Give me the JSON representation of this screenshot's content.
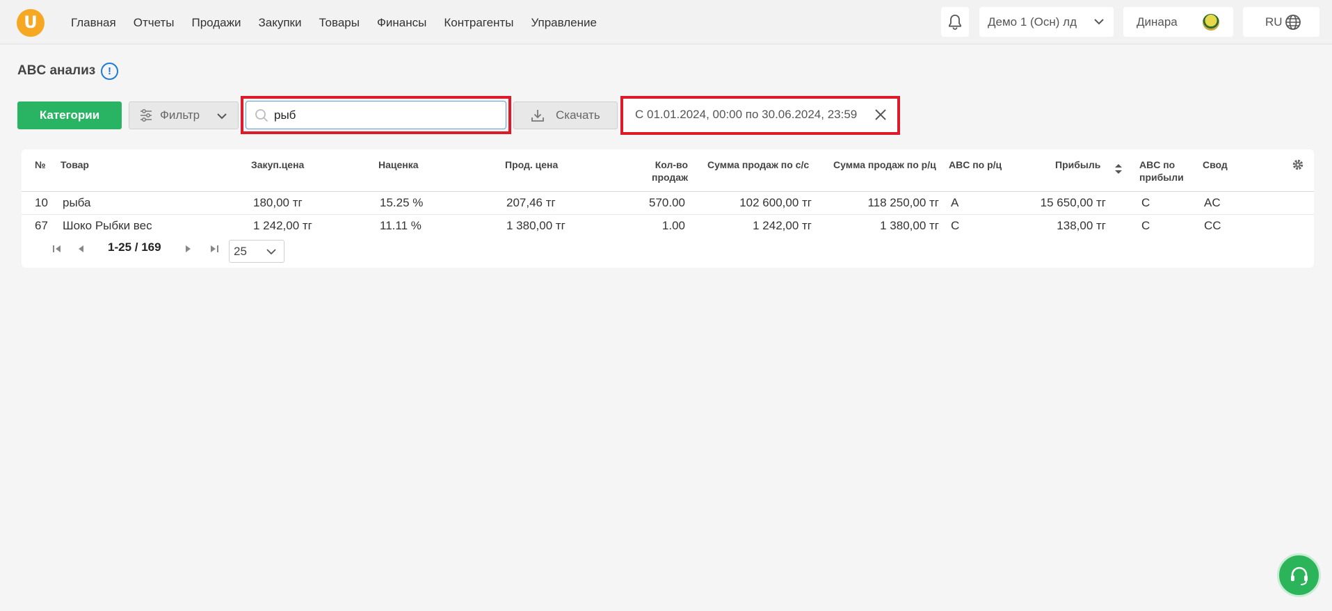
{
  "header": {
    "logo_letter": "U",
    "nav": [
      "Главная",
      "Отчеты",
      "Продажи",
      "Закупки",
      "Товары",
      "Финансы",
      "Контрагенты",
      "Управление"
    ],
    "company": "Демо 1 (Осн) лд",
    "user": "Динара",
    "language": "RU"
  },
  "page": {
    "title": "ABC анализ",
    "info_symbol": "!"
  },
  "toolbar": {
    "categories_label": "Категории",
    "filter_label": "Фильтр",
    "search_value": "рыб",
    "download_label": "Скачать",
    "date_range": "С 01.01.2024, 00:00 по 30.06.2024, 23:59"
  },
  "table": {
    "headers": {
      "num": "№",
      "product": "Товар",
      "purchase_price": "Закуп.цена",
      "markup": "Наценка",
      "sale_price": "Прод. цена",
      "qty_line1": "Кол-во",
      "qty_line2": "продаж",
      "sum_cost": "Сумма продаж по с/с",
      "sum_retail": "Сумма продаж по р/ц",
      "abc_retail": "ABC по р/ц",
      "profit": "Прибыль",
      "abc_profit_line1": "ABC по",
      "abc_profit_line2": "прибыли",
      "summary": "Свод"
    },
    "rows": [
      {
        "num": "10",
        "product": "рыба",
        "purchase_price": "180,00 тг",
        "markup": "15.25 %",
        "sale_price": "207,46 тг",
        "qty": "570.00",
        "sum_cost": "102 600,00 тг",
        "sum_retail": "118 250,00 тг",
        "abc_retail": "A",
        "profit": "15 650,00 тг",
        "abc_profit": "C",
        "summary": "AC"
      },
      {
        "num": "67",
        "product": "Шоко Рыбки вес",
        "purchase_price": "1 242,00 тг",
        "markup": "11.11 %",
        "sale_price": "1 380,00 тг",
        "qty": "1.00",
        "sum_cost": "1 242,00 тг",
        "sum_retail": "1 380,00 тг",
        "abc_retail": "C",
        "profit": "138,00 тг",
        "abc_profit": "C",
        "summary": "CC"
      }
    ]
  },
  "pagination": {
    "range": "1-25 / 169",
    "page_size": "25"
  },
  "icons": [
    "bell-icon",
    "chevron-down-icon",
    "globe-icon",
    "info-icon",
    "filter-icon",
    "search-icon",
    "download-icon",
    "close-icon",
    "sort-icon",
    "gear-icon",
    "first-page-icon",
    "prev-page-icon",
    "next-page-icon",
    "last-page-icon",
    "headset-icon"
  ],
  "colors": {
    "accent_green": "#28b463",
    "logo_orange": "#f7a823",
    "highlight_red": "#dd1a2a",
    "info_blue": "#1e7bd6"
  }
}
